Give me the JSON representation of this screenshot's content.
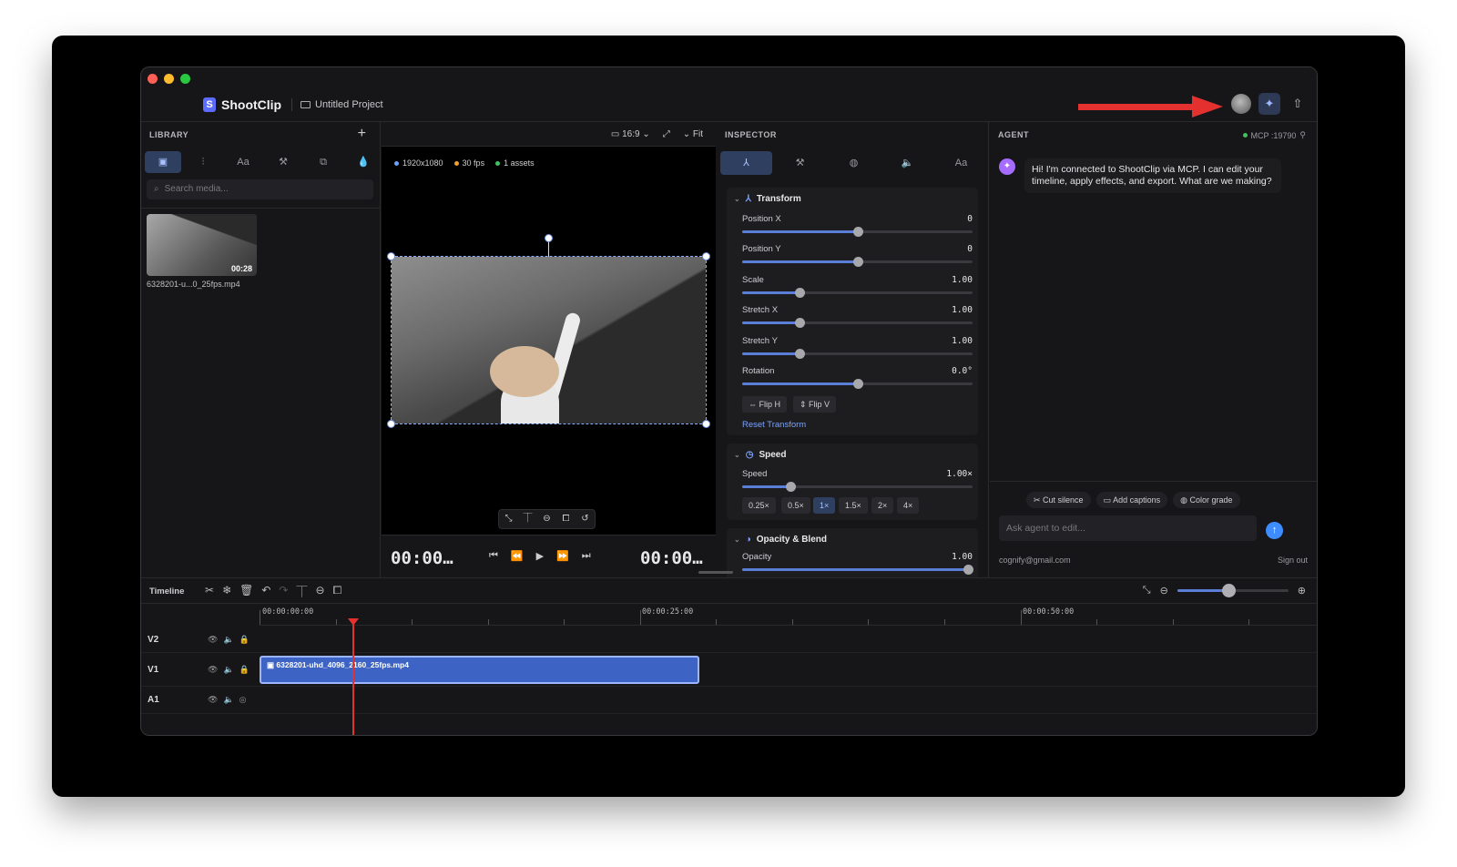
{
  "app": {
    "name": "ShootClip",
    "project": "Untitled Project"
  },
  "library": {
    "header": "LIBRARY",
    "add_icon": "+",
    "tabs": [
      "media-icon",
      "audio-icon",
      "text-icon",
      "effects-icon",
      "transitions-icon",
      "color-icon"
    ],
    "tab_glyphs": [
      "▣",
      "⫶",
      "Aa",
      "⚒",
      "⧉",
      "💧"
    ],
    "search_placeholder": "Search media...",
    "items": [
      {
        "name": "6328201-u...0_25fps.mp4",
        "duration": "00:28"
      }
    ]
  },
  "preview": {
    "aspect": "16:9",
    "fit": "Fit",
    "meta": [
      {
        "text": "1920x1080",
        "color": "#6aa0ff"
      },
      {
        "text": "30 fps",
        "color": "#f0a030"
      },
      {
        "text": "1 assets",
        "color": "#40c060"
      }
    ],
    "timecode_current": "00:00…",
    "timecode_total": "00:00…"
  },
  "inspector": {
    "header": "INSPECTOR",
    "tabs": [
      "⅄",
      "⚒",
      "◍",
      "🔈",
      "Aa"
    ],
    "transform": {
      "title": "Transform",
      "props": [
        {
          "label": "Position X",
          "value": "0",
          "level": 0.5
        },
        {
          "label": "Position Y",
          "value": "0",
          "level": 0.5
        },
        {
          "label": "Scale",
          "value": "1.00",
          "level": 0.25
        },
        {
          "label": "Stretch X",
          "value": "1.00",
          "level": 0.25
        },
        {
          "label": "Stretch Y",
          "value": "1.00",
          "level": 0.25
        },
        {
          "label": "Rotation",
          "value": "0.0°",
          "level": 0.5
        }
      ],
      "flip_h": "⇔ Flip H",
      "flip_v": "⇕ Flip V",
      "reset": "Reset Transform"
    },
    "speed": {
      "title": "Speed",
      "label": "Speed",
      "value": "1.00×",
      "level": 0.21,
      "presets": [
        "0.25×",
        "0.5×",
        "1×",
        "1.5×",
        "2×",
        "4×"
      ],
      "active": "1×"
    },
    "opacity": {
      "title": "Opacity & Blend",
      "label": "Opacity",
      "value": "1.00",
      "level": 0.98
    }
  },
  "agent": {
    "header": "AGENT",
    "mcp": "MCP :19790",
    "message": "Hi! I'm connected to ShootClip via MCP. I can edit your timeline, apply effects, and export. What are we making?",
    "chips": [
      "✂ Cut silence",
      "▭ Add captions",
      "◍ Color grade"
    ],
    "input_placeholder": "Ask agent to edit...",
    "email": "cognify@gmail.com",
    "signout": "Sign out"
  },
  "timeline": {
    "title": "Timeline",
    "ruler": [
      "00:00:00:00",
      "00:00:25:00",
      "00:00:50:00"
    ],
    "tracks": [
      "V2",
      "V1",
      "A1"
    ],
    "clip": "6328201-uhd_4096_2160_25fps.mp4",
    "zoom_level": 0.46
  }
}
